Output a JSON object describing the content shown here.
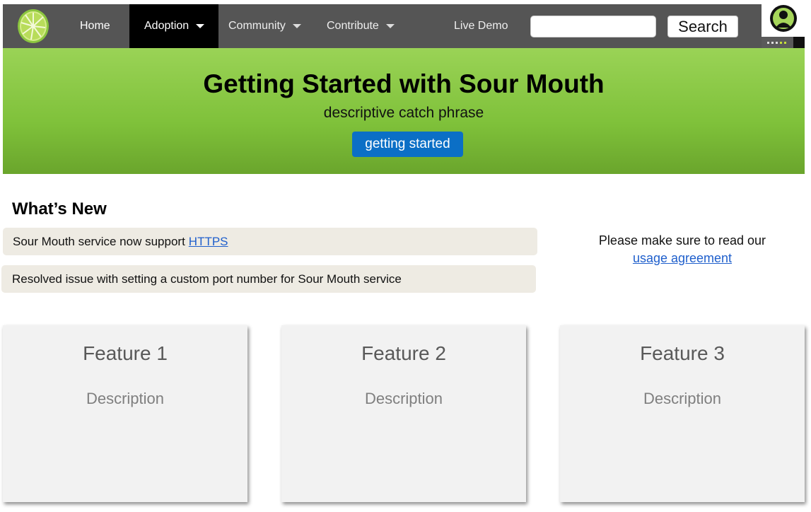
{
  "nav": {
    "items": [
      {
        "label": "Home"
      },
      {
        "label": "Adoption"
      },
      {
        "label": "Community"
      },
      {
        "label": "Contribute"
      },
      {
        "label": "Live Demo"
      }
    ],
    "active": "Adoption",
    "search_value": "",
    "search_button": "Search",
    "logo_icon": "lime-logo-icon",
    "avatar_icon": "user-avatar-icon"
  },
  "hero": {
    "title": "Getting Started with Sour Mouth",
    "tagline": "descriptive catch phrase",
    "button": "getting started"
  },
  "whats_new": {
    "title": "What’s New",
    "items": [
      {
        "text": "Sour Mouth service now support",
        "link": "HTTPS"
      },
      {
        "text": "Resolved issue with setting a custom port number for Sour Mouth service"
      }
    ]
  },
  "notice": {
    "text": "Please make sure to read our",
    "link": "usage agreement"
  },
  "features": [
    {
      "title": "Feature 1",
      "description": "Description"
    },
    {
      "title": "Feature 2",
      "description": "Description"
    },
    {
      "title": "Feature 3",
      "description": "Description"
    }
  ],
  "colors": {
    "nav_bg": "#555555",
    "nav_active": "#000000",
    "hero_green": "#7fc13a",
    "primary_button": "#0b6fc6",
    "news_bg": "#eeebe3",
    "link": "#1f5fcc",
    "card_bg": "#f2f2f2"
  }
}
